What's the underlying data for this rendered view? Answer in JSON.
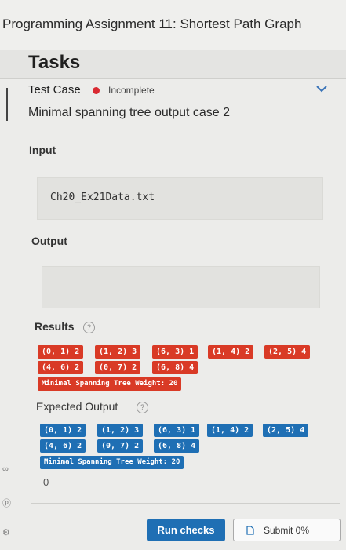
{
  "header": {
    "title": "Programming Assignment 11: Shortest Path Graph"
  },
  "tasks": {
    "heading": "Tasks"
  },
  "test_case": {
    "label": "Test Case",
    "status": "Incomplete",
    "name": "Minimal spanning tree output case 2"
  },
  "input": {
    "label": "Input",
    "value": "Ch20_Ex21Data.txt"
  },
  "output": {
    "label": "Output",
    "value": ""
  },
  "results": {
    "label": "Results",
    "chips": [
      "(0, 1) 2",
      "(1, 2) 3",
      "(6, 3) 1",
      "(1, 4) 2",
      "(2, 5) 4",
      "(4, 6) 2",
      "(0, 7) 2",
      "(6, 8) 4"
    ],
    "summary": "Minimal Spanning Tree Weight: 20"
  },
  "expected": {
    "label": "Expected Output",
    "chips": [
      "(0, 1) 2",
      "(1, 2) 3",
      "(6, 3) 1",
      "(1, 4) 2",
      "(2, 5) 4",
      "(4, 6) 2",
      "(0, 7) 2",
      "(6, 8) 4"
    ],
    "summary": "Minimal Spanning Tree Weight: 20",
    "extra": "0"
  },
  "actions": {
    "run_label": "Run checks",
    "submit_label": "Submit 0%"
  },
  "colors": {
    "status_red": "#d92a32",
    "result_red": "#d93a26",
    "expected_blue": "#1f6fb4"
  },
  "icons": [
    "chevron-down-icon",
    "help-circle-icon",
    "document-icon"
  ]
}
